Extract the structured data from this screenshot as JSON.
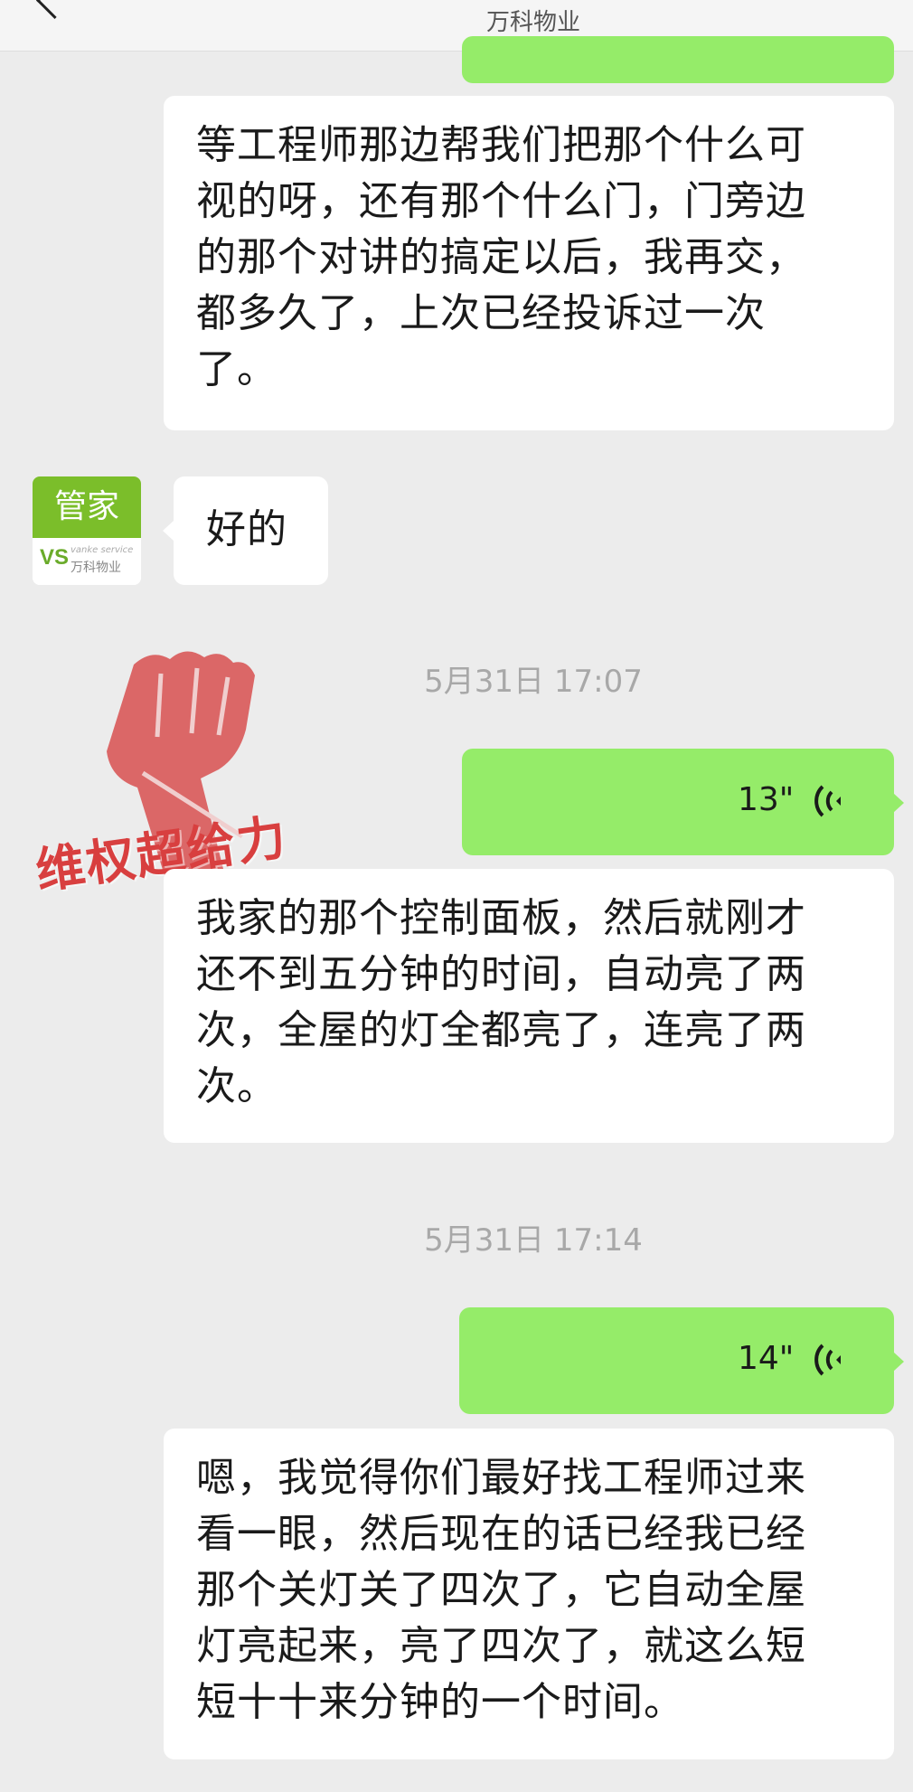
{
  "header": {
    "title": "万科物业"
  },
  "messages": {
    "m1_lines": [
      "等工程师那边帮我们把那个什么可",
      "视的呀，还有那个什么门，门旁边",
      "的那个对讲的搞定以后，我再交，",
      "都多久了，上次已经投诉过一次",
      "了。"
    ],
    "m2_text": "好的",
    "ts1": "5月31日 17:07",
    "voice1_duration": "13\"",
    "m3_lines": [
      "我家的那个控制面板，然后就刚才",
      "还不到五分钟的时间，自动亮了两",
      "次，全屋的灯全都亮了，连亮了两",
      "次。"
    ],
    "ts2": "5月31日 17:14",
    "voice2_duration": "14\"",
    "m4_lines": [
      "嗯，我觉得你们最好找工程师过来",
      "看一眼，然后现在的话已经我已经",
      "那个关灯关了四次了，它自动全屋",
      "灯亮起来，亮了四次了，就这么短",
      "短十十来分钟的一个时间。"
    ]
  },
  "avatar": {
    "label": "管家",
    "brand": "万科物业",
    "brand_en": "vanke service",
    "logo": "VS"
  },
  "watermark": {
    "text": "维权超给力",
    "icon": "raised-fist-icon"
  },
  "colors": {
    "green_bubble": "#95ec69",
    "white_bubble": "#ffffff",
    "background": "#ececec",
    "timestamp": "#a8a8a8",
    "avatar_green": "#7bbe2a",
    "watermark_red": "#d83f3f"
  }
}
